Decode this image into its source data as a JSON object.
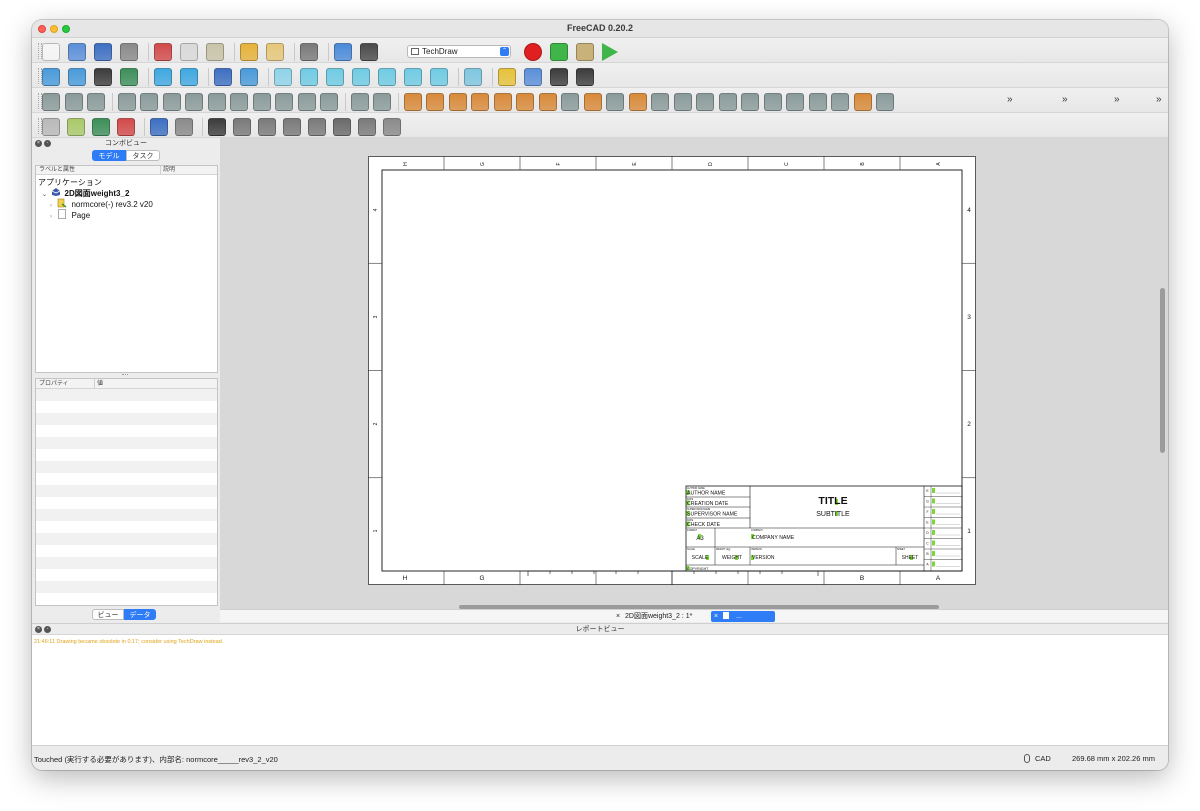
{
  "window": {
    "title": "FreeCAD 0.20.2"
  },
  "toolbar": {
    "workbench": "TechDraw",
    "overflow_marker": "»",
    "icons": {
      "row1": [
        "new-document-icon",
        "open-document-icon",
        "save-document-icon",
        "save-as-icon",
        "cut-icon",
        "copy-icon",
        "paste-icon",
        "undo-icon",
        "redo-icon",
        "refresh-icon",
        "recompute-icon",
        "whats-this-icon",
        "macro-record-icon",
        "macro-stop-icon",
        "macro-edit-icon",
        "macro-run-icon"
      ],
      "row2": [
        "fit-all-icon",
        "fit-selection-icon",
        "draw-style-icon",
        "bounding-box-icon",
        "back-icon",
        "forward-icon",
        "workbench-view-icon",
        "zoom-icon",
        "isometric-view-icon",
        "front-view-icon",
        "top-view-icon",
        "right-view-icon",
        "rear-view-icon",
        "bottom-view-icon",
        "left-view-icon",
        "measure-distance-icon",
        "part-icon",
        "folder-icon",
        "link-icon",
        "link-actions-icon"
      ],
      "row3": [
        "new-page-icon",
        "template-page-icon",
        "redraw-page-icon",
        "insert-view-icon",
        "active-view-icon",
        "projection-group-icon",
        "section-view-icon",
        "detail-view-icon",
        "draft-view-icon",
        "arch-view-icon",
        "spreadsheet-view-icon",
        "symbol-icon",
        "clip-group-icon",
        "clip-add-icon",
        "clip-remove-icon",
        "length-dimension-icon",
        "horizontal-dimension-icon",
        "vertical-dimension-icon",
        "radius-dimension-icon",
        "diameter-dimension-icon",
        "angle-dimension-icon",
        "angle-3pt-dimension-icon",
        "horizontal-extent-icon",
        "link-dimension-icon",
        "balloon-icon",
        "landmark-dimension-icon",
        "toggle-frames-icon",
        "export-svg-icon",
        "leader-line-icon",
        "rich-annotation-icon",
        "cosmetic-vertex-icon",
        "centerline-icon",
        "weld-symbol-icon",
        "cosmetic-circle-icon",
        "thread-icon",
        "chain-dimension-icon",
        "export-page-icon"
      ],
      "row4": [
        "hatch-icon",
        "geom-hatch-icon",
        "image-icon",
        "toggle-frame-icon",
        "annotation-icon",
        "cosmetic-vertex-add-icon",
        "leader-icon",
        "circle-centerline-icon",
        "face-centerline-icon",
        "line-icon",
        "decorate-icon",
        "pencil-icon",
        "show-all-icon",
        "page-template-icon"
      ]
    }
  },
  "combo_view": {
    "title": "コンボビュー",
    "tabs": [
      "モデル",
      "タスク"
    ],
    "tree_header": {
      "label": "ラベルと属性",
      "description": "説明"
    },
    "tree": {
      "root": "アプリケーション",
      "document": "2D図面weight3_2",
      "items": [
        {
          "label": "normcore(-) rev3.2 v20",
          "icon": "drawing-page-icon"
        },
        {
          "label": "Page",
          "icon": "page-icon"
        }
      ]
    },
    "props_header": {
      "property": "プロパティ",
      "value": "値"
    },
    "bottom_tabs": [
      "ビュー",
      "データ"
    ]
  },
  "drawing": {
    "col_labels_top": [
      "H",
      "G",
      "F",
      "E",
      "D",
      "C",
      "B",
      "A"
    ],
    "col_labels_bottom": [
      "H",
      "G",
      "B",
      "A"
    ],
    "row_labels": [
      "4",
      "3",
      "2",
      "1"
    ],
    "title_block": {
      "author_caption": "AUTHOR NAME",
      "author": "AUTHOR NAME",
      "creation_date_caption": "DATE",
      "creation_date": "CREATION DATE",
      "supervisor_caption": "SUPERVISOR NAME",
      "supervisor": "SUPERVISOR NAME",
      "check_date_caption": "DATE",
      "check_date": "CHECK DATE",
      "title": "TITLE",
      "subtitle": "SUBTITLE",
      "format_caption": "FORMAT",
      "format": "A3",
      "company_caption": "COMPANY",
      "company": "COMPANY NAME",
      "scale_caption": "SCALE",
      "scale": "SCALE",
      "weight_caption": "WEIGHT (kg)",
      "weight": "WEIGHT",
      "version_caption": "VERSION",
      "version": "VERSION",
      "sheet_caption": "SHEET",
      "sheet": "SHEET",
      "copyright": "COPYRIGHT",
      "revision_letters": [
        "E",
        "G",
        "F",
        "E",
        "D",
        "C",
        "B",
        "A"
      ]
    }
  },
  "doc_tabs": [
    {
      "label": "2D図面weight3_2 : 1*",
      "active": false
    },
    {
      "label": "...",
      "active": true
    }
  ],
  "report_view": {
    "title": "レポートビュー",
    "message": "21:46:11  Drawing became obsolete in 0.17; consider using TechDraw instead."
  },
  "statusbar": {
    "text": "Touched (実行する必要があります)、内部名: normcore_____rev3_2_v20",
    "nav_style": "CAD",
    "dimensions": "269.68 mm x 202.26 mm"
  },
  "colors": {
    "accent": "#2f7df6",
    "record": "#e02020",
    "warning_text": "#e0a21a",
    "editable_field": "#7cd83a"
  }
}
